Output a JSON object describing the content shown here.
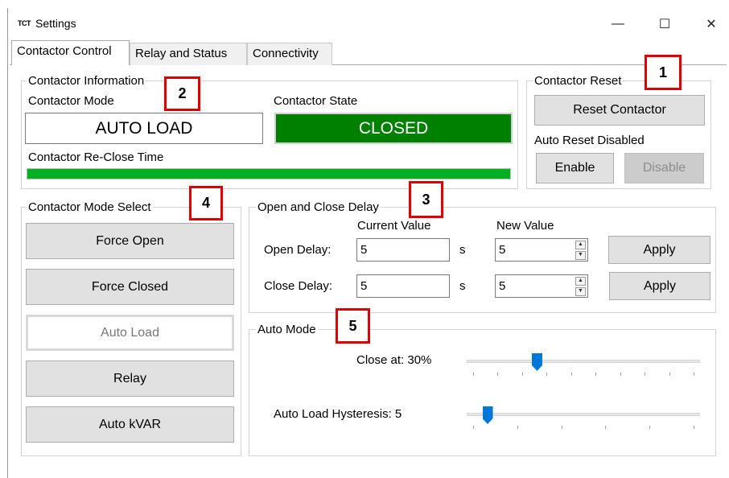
{
  "window": {
    "app_icon_text": "TCT",
    "title": "Settings",
    "minimize": "—",
    "maximize": "☐",
    "close": "✕"
  },
  "tabs": [
    "Contactor Control",
    "Relay and Status",
    "Connectivity"
  ],
  "contactor_info": {
    "group_label": "Contactor Information",
    "mode_label": "Contactor Mode",
    "mode_value": "AUTO LOAD",
    "state_label": "Contactor State",
    "state_value": "CLOSED",
    "state_color": "#008000",
    "reclose_label": "Contactor Re-Close Time",
    "reclose_progress": 1.0,
    "progress_color": "#06b025"
  },
  "contactor_reset": {
    "group_label": "Contactor Reset",
    "reset_button": "Reset Contactor",
    "status_text": "Auto Reset Disabled",
    "enable_button": "Enable",
    "disable_button": "Disable"
  },
  "mode_select": {
    "group_label": "Contactor Mode Select",
    "buttons": [
      "Force Open",
      "Force Closed",
      "Auto Load",
      "Relay",
      "Auto kVAR"
    ],
    "selected": "Auto Load"
  },
  "delay": {
    "group_label": "Open and Close Delay",
    "current_header": "Current Value",
    "new_header": "New Value",
    "rows": [
      {
        "label": "Open Delay:",
        "current": "5",
        "unit": "s",
        "new": "5",
        "apply": "Apply"
      },
      {
        "label": "Close Delay:",
        "current": "5",
        "unit": "s",
        "new": "5",
        "apply": "Apply"
      }
    ]
  },
  "auto_mode": {
    "group_label": "Auto Mode",
    "close_at_label": "Close at: 30%",
    "close_at_value": 30,
    "hysteresis_label": "Auto Load Hysteresis: 5",
    "hysteresis_value": 5
  },
  "annotations": [
    "1",
    "2",
    "3",
    "4",
    "5"
  ],
  "colors": {
    "annotation_border": "#e00000",
    "slider_thumb": "#0078d7"
  }
}
